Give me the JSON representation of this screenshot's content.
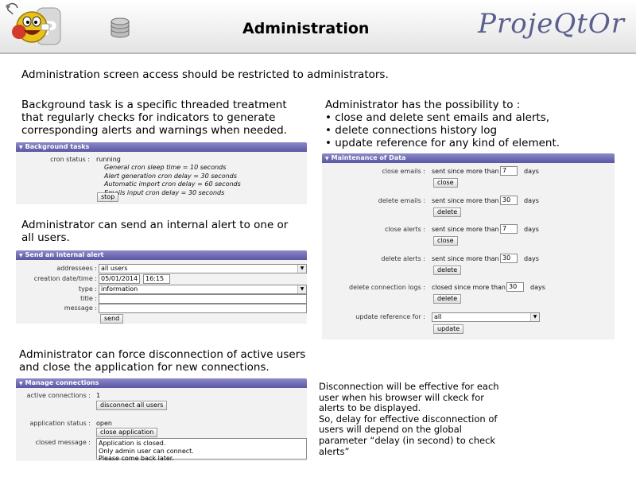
{
  "header": {
    "title": "Administration",
    "brand": "ProjeQtOr"
  },
  "intro": "Administration screen access should be restricted to administrators.",
  "bg_para": [
    "Background task is a specific threaded treatment",
    "that regularly checks for indicators to generate",
    "corresponding alerts and warnings when needed."
  ],
  "admin_para": [
    "Administrator has the possibility to :",
    "• close and delete sent emails and alerts,",
    "• delete connections history log",
    "• update reference for any kind of element."
  ],
  "alert_para": [
    "Administrator can send an internal alert to one or",
    "all users."
  ],
  "disc_para": [
    "Administrator can force disconnection of active users",
    "and close the application for new connections."
  ],
  "note": [
    "Disconnection will be effective for each",
    "user when his browser will ckeck for",
    "alerts to be displayed.",
    "So, delay for effective disconnection of",
    "users will depend on the global",
    "parameter “delay (in second) to check",
    "alerts”"
  ],
  "background_tasks": {
    "title": "Background tasks",
    "cron_label": "cron status :",
    "cron_value": "running",
    "details": [
      "General cron sleep time = 10 seconds",
      "Alert generation cron delay = 30 seconds",
      "Automatic import cron delay = 60 seconds",
      "Emails input cron delay = 30 seconds"
    ],
    "stop_label": "stop"
  },
  "send_alert": {
    "title": "Send an internal alert",
    "addressees_label": "addressees :",
    "addressees_value": "all users",
    "date_label": "creation date/time :",
    "date_value": "05/01/2014",
    "time_value": "16:15",
    "type_label": "type :",
    "type_value": "information",
    "title_label": "title :",
    "message_label": "message :",
    "send_label": "send"
  },
  "maintenance": {
    "title": "Maintenance of Data",
    "rows": [
      {
        "label": "close emails :",
        "text": "sent since more than",
        "value": "7",
        "unit": "days",
        "button": "close"
      },
      {
        "label": "delete emails :",
        "text": "sent since more than",
        "value": "30",
        "unit": "days",
        "button": "delete"
      },
      {
        "label": "close alerts :",
        "text": "sent since more than",
        "value": "7",
        "unit": "days",
        "button": "close"
      },
      {
        "label": "delete alerts :",
        "text": "sent since more than",
        "value": "30",
        "unit": "days",
        "button": "delete"
      },
      {
        "label": "delete connection logs :",
        "text": "closed since more than",
        "value": "30",
        "unit": "days",
        "button": "delete"
      }
    ],
    "update_label": "update reference for :",
    "update_value": "all",
    "update_button": "update"
  },
  "manage": {
    "title": "Manage connections",
    "active_label": "active connections :",
    "active_value": "1",
    "disconnect_label": "disconnect all users",
    "status_label": "application status :",
    "status_value": "open",
    "close_app_label": "close application",
    "closed_msg_label": "closed message :",
    "closed_msg_lines": [
      "Application is closed.",
      "Only admin user can connect.",
      "Please come back later."
    ]
  }
}
